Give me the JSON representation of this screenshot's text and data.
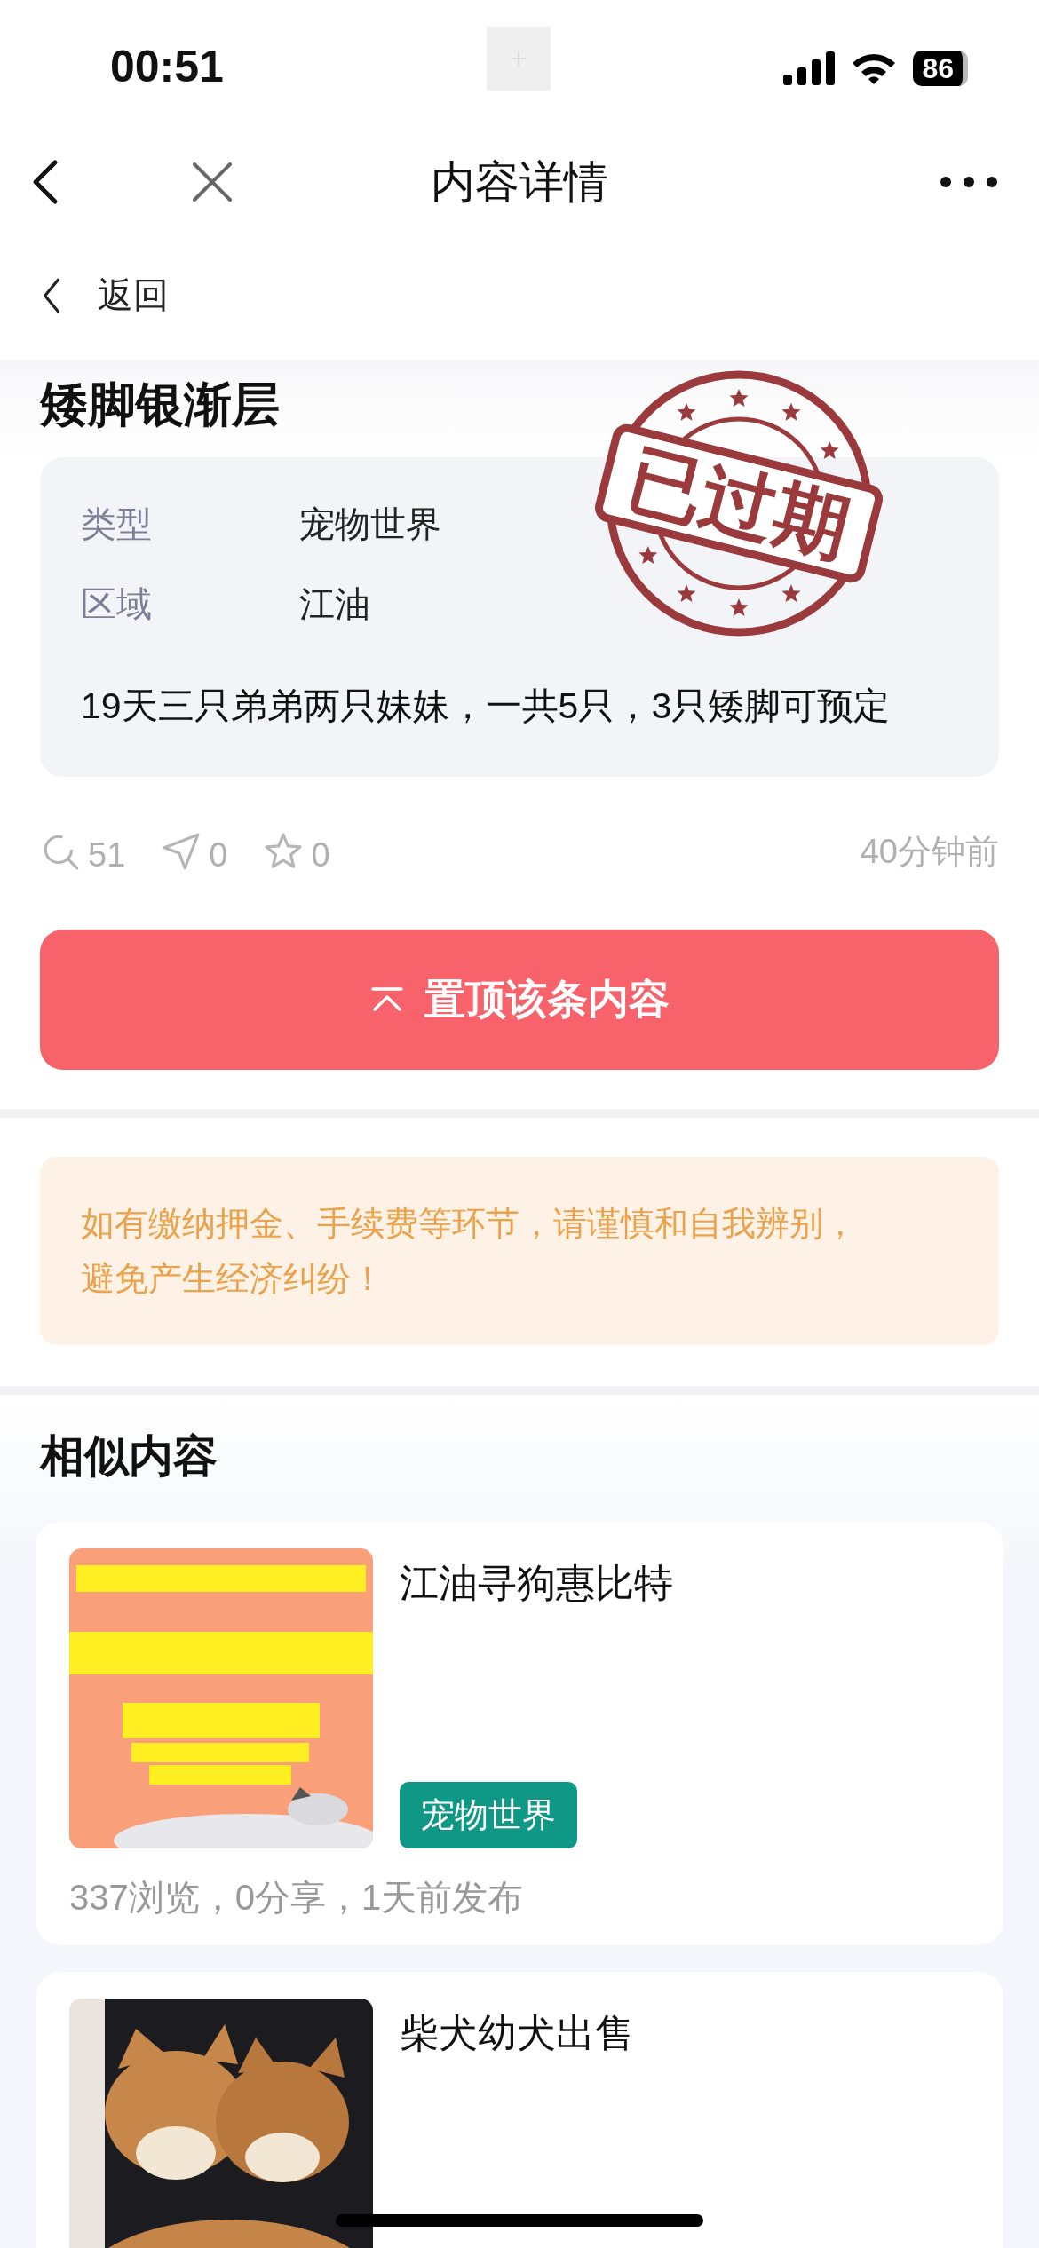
{
  "status_bar": {
    "time": "00:51",
    "battery": "86"
  },
  "nav": {
    "title": "内容详情"
  },
  "back": {
    "label": "返回"
  },
  "post": {
    "title": "矮脚银渐层",
    "fields": [
      {
        "label": "类型",
        "value": "宠物世界"
      },
      {
        "label": "区域",
        "value": "江油"
      }
    ],
    "description": "19天三只弟弟两只妹妹，一共5只，3只矮脚可预定",
    "stamp": "已过期",
    "stats": [
      {
        "kind": "views",
        "value": "51"
      },
      {
        "kind": "shares",
        "value": "0"
      },
      {
        "kind": "favorites",
        "value": "0"
      }
    ],
    "time": "40分钟前"
  },
  "pin_button": {
    "label": "置顶该条内容"
  },
  "notice": "如有缴纳押金、手续费等环节，请谨慎和自我辨别，避免产生经济纠纷！",
  "similar": {
    "heading": "相似内容",
    "items": [
      {
        "title": "江油寻狗惠比特",
        "tag": "宠物世界",
        "meta": "337浏览，0分享，1天前发布"
      },
      {
        "title": "柴犬幼犬出售"
      }
    ]
  }
}
